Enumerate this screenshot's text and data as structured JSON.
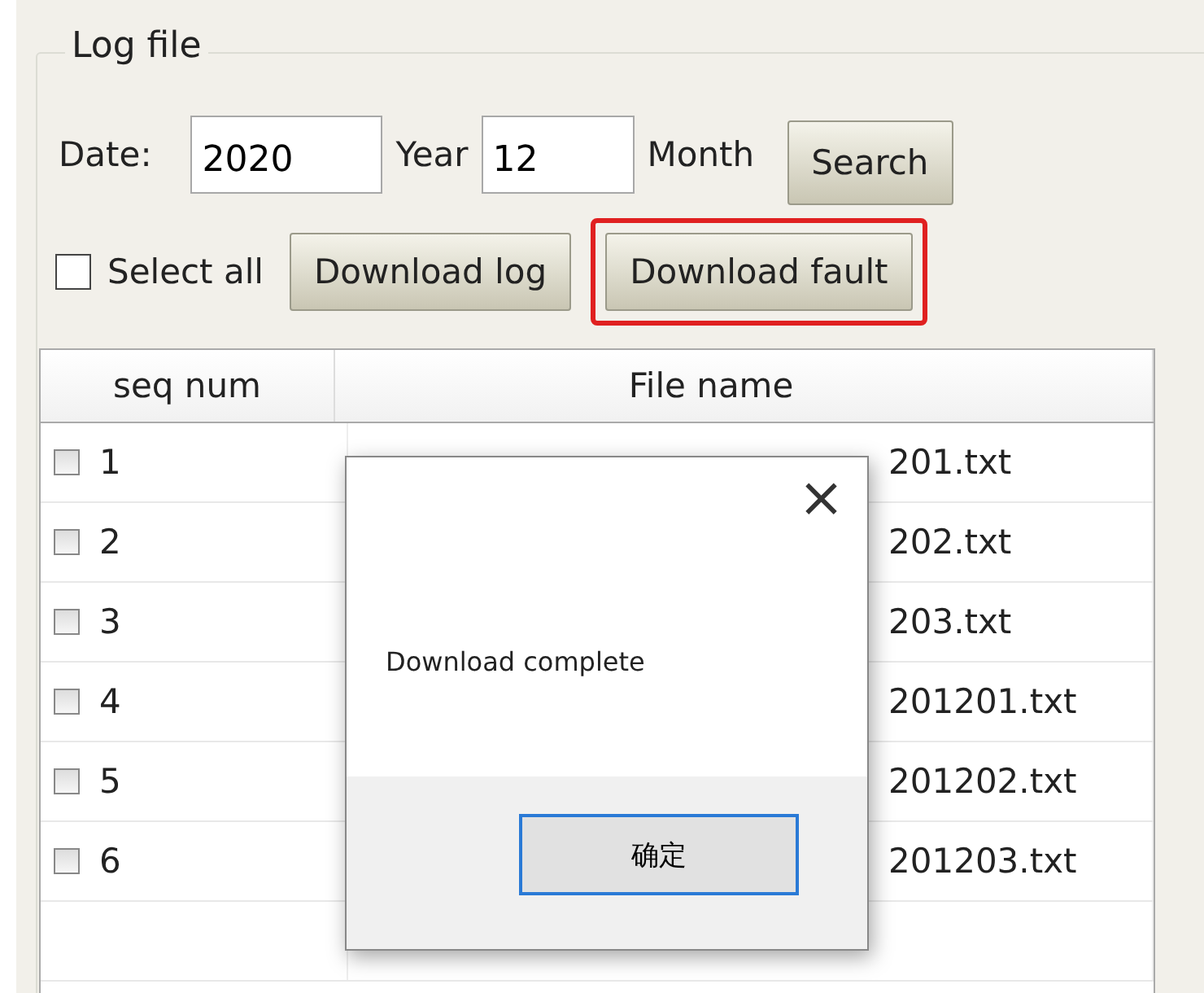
{
  "group": {
    "title": "Log file"
  },
  "date": {
    "label": "Date:",
    "year_value": "2020",
    "year_label": "Year",
    "month_value": "12",
    "month_label": "Month"
  },
  "buttons": {
    "search": "Search",
    "download_log": "Download log",
    "download_fault": "Download fault",
    "download_fault_highlighted": true
  },
  "select_all": {
    "label": "Select all",
    "checked": false
  },
  "table": {
    "columns": [
      "seq num",
      "File name"
    ],
    "rows": [
      {
        "seq": "1",
        "file": "201.txt",
        "checked": false
      },
      {
        "seq": "2",
        "file": "202.txt",
        "checked": false
      },
      {
        "seq": "3",
        "file": "203.txt",
        "checked": false
      },
      {
        "seq": "4",
        "file": "201201.txt",
        "checked": false
      },
      {
        "seq": "5",
        "file": "201202.txt",
        "checked": false
      },
      {
        "seq": "6",
        "file": "201203.txt",
        "checked": false
      }
    ]
  },
  "dialog": {
    "close": "×",
    "message": "Download complete",
    "ok": "确定"
  }
}
